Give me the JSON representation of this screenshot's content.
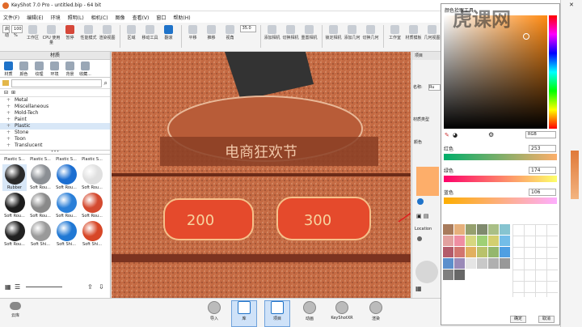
{
  "app": {
    "title": "KeyShot 7.0 Pro  -  untitled.bip  -  64 bit"
  },
  "menu": [
    "文件(F)",
    "编辑(E)",
    "环境",
    "照明(L)",
    "相机(C)",
    "图像",
    "查看(V)",
    "窗口",
    "帮助(H)"
  ],
  "toolbar": {
    "mode_select": "启动",
    "zoom": "100 %",
    "buttons": [
      "工作区",
      "CPU 使用量",
      "暂停",
      "性能模式",
      "渲染视图",
      "区域",
      "移动工具",
      "翻滚",
      "平移",
      "推移",
      "视角",
      "添加相机",
      "切换相机",
      "重置相机",
      "锁定相机",
      "添加几何",
      "切换几何",
      "工作室",
      "材质模板",
      "几何视图",
      "配置程序向导"
    ],
    "fov_value": "35.0"
  },
  "left_panel": {
    "header": "材质",
    "tabs": [
      "材质",
      "颜色",
      "纹理",
      "环境",
      "背景",
      "收藏..."
    ],
    "search_placeholder": "",
    "tree": [
      {
        "label": "Metal",
        "selected": false
      },
      {
        "label": "Miscellaneous",
        "selected": false
      },
      {
        "label": "Mold-Tech",
        "selected": false
      },
      {
        "label": "Paint",
        "selected": false
      },
      {
        "label": "Plastic",
        "selected": true
      },
      {
        "label": "Stone",
        "selected": false
      },
      {
        "label": "Toon",
        "selected": false
      },
      {
        "label": "Translucent",
        "selected": false
      }
    ],
    "thumbs": [
      {
        "label": "Plastic S...",
        "color": "#2a2a2a"
      },
      {
        "label": "Plastic S...",
        "color": "#8b8f94"
      },
      {
        "label": "Plastic S...",
        "color": "#1b6ed1"
      },
      {
        "label": "Plastic S...",
        "color": "#e0e0e0"
      },
      {
        "label": "Rubber",
        "color": "#1c1c1c"
      },
      {
        "label": "Soft Rou...",
        "color": "#8a8a8a"
      },
      {
        "label": "Soft Rou...",
        "color": "#2a7fd8"
      },
      {
        "label": "Soft Rou...",
        "color": "#d44a2f"
      },
      {
        "label": "Soft Rou...",
        "color": "#222222"
      },
      {
        "label": "Soft Rou...",
        "color": "#9a9a9a"
      },
      {
        "label": "Soft Rou...",
        "color": "#2078d4"
      },
      {
        "label": "Soft Rou...",
        "color": "#d74727"
      },
      {
        "label": "Soft Rou...",
        "color": "#bdbdbd"
      },
      {
        "label": "Soft Shi...",
        "color": "#dcdcdc"
      },
      {
        "label": "Soft Shi...",
        "color": "#1a1a1a"
      },
      {
        "label": "Soft Shi...",
        "color": "#1e70cf"
      }
    ]
  },
  "viewport": {
    "badge1": "200",
    "badge2": "300",
    "banner": "电商狂欢节"
  },
  "right_panel": {
    "header": "项目",
    "label1": "名称:",
    "field1": "Ru",
    "label2": "材质类型",
    "label3": "漫反",
    "label4": "颜色",
    "label5": "Location"
  },
  "picker": {
    "title": "颜色拾取工具",
    "mode": "RGB",
    "sliders": [
      {
        "label": "红色",
        "value": "253"
      },
      {
        "label": "绿色",
        "value": "174"
      },
      {
        "label": "蓝色",
        "value": "106"
      }
    ],
    "ok": "确定",
    "cancel": "取消",
    "swatches": [
      "#a87b5c",
      "#e6b07c",
      "#95a06e",
      "#7f8a6e",
      "#a9bf86",
      "#86c4d0",
      "#e2a19f",
      "#ef8ea2",
      "#d6d77f",
      "#9fd075",
      "#d3cf6f",
      "#73bde8",
      "#b35b6a",
      "#d2756f",
      "#e2b05f",
      "#b9c26b",
      "#94b76d",
      "#4f9fe2",
      "#5b8fcc",
      "#9a8ab8",
      "#e5e5e5",
      "#c8c8c8",
      "#b0b0b0",
      "#989898",
      "#7f7f7f",
      "#676767"
    ]
  },
  "bottombar": {
    "buttons": [
      {
        "label": "导入",
        "selected": false
      },
      {
        "label": "库",
        "selected": true
      },
      {
        "label": "项目",
        "selected": true
      },
      {
        "label": "动画",
        "selected": false
      },
      {
        "label": "KeyShotXR",
        "selected": false
      },
      {
        "label": "渲染",
        "selected": false
      }
    ],
    "cloud_label": "云库"
  },
  "watermark": "虎课网",
  "colors": {
    "accent": "#1f73c9",
    "picked": "#fdae6a",
    "scene": "#c8673e"
  }
}
